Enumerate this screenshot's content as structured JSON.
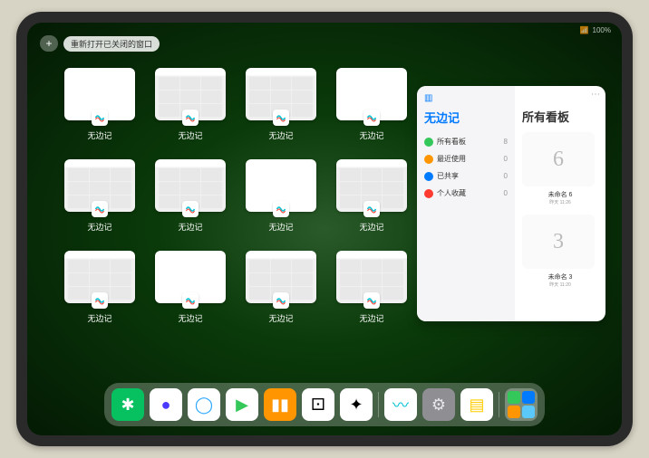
{
  "status": {
    "wifi": "📶",
    "battery": "100%"
  },
  "topbar": {
    "plus": "+",
    "reopen_label": "重新打开已关闭的窗口"
  },
  "windows": [
    {
      "label": "无边记",
      "variant": "blank"
    },
    {
      "label": "无边记",
      "variant": "content"
    },
    {
      "label": "无边记",
      "variant": "content"
    },
    {
      "label": "无边记",
      "variant": "blank"
    },
    {
      "label": "无边记",
      "variant": "content"
    },
    {
      "label": "无边记",
      "variant": "content"
    },
    {
      "label": "无边记",
      "variant": "blank"
    },
    {
      "label": "无边记",
      "variant": "content"
    },
    {
      "label": "无边记",
      "variant": "content"
    },
    {
      "label": "无边记",
      "variant": "blank"
    },
    {
      "label": "无边记",
      "variant": "content"
    },
    {
      "label": "无边记",
      "variant": "content"
    }
  ],
  "panel": {
    "title": "无边记",
    "right_title": "所有看板",
    "items": [
      {
        "label": "所有看板",
        "count": 8,
        "color": "#34c759"
      },
      {
        "label": "最近使用",
        "count": 0,
        "color": "#ff9500"
      },
      {
        "label": "已共享",
        "count": 0,
        "color": "#007aff"
      },
      {
        "label": "个人收藏",
        "count": 0,
        "color": "#ff3b30"
      }
    ],
    "boards": [
      {
        "glyph": "6",
        "name": "未命名 6",
        "time": "昨天 11:26"
      },
      {
        "glyph": "3",
        "name": "未命名 3",
        "time": "昨天 11:20"
      }
    ]
  },
  "dock": {
    "icons": [
      {
        "name": "wechat",
        "bg": "#07c160",
        "glyph": "✱"
      },
      {
        "name": "browser-1",
        "bg": "#ffffff",
        "glyph": "●",
        "fg": "#4a3aff"
      },
      {
        "name": "browser-2",
        "bg": "#ffffff",
        "glyph": "◯",
        "fg": "#2aa7ff"
      },
      {
        "name": "play",
        "bg": "#ffffff",
        "glyph": "▶",
        "fg": "#34c759"
      },
      {
        "name": "books",
        "bg": "#ff9500",
        "glyph": "▮▮",
        "fg": "#fff"
      },
      {
        "name": "dice",
        "bg": "#ffffff",
        "glyph": "⚀",
        "fg": "#000"
      },
      {
        "name": "atoms",
        "bg": "#ffffff",
        "glyph": "✦",
        "fg": "#000"
      },
      {
        "name": "freeform",
        "bg": "#ffffff",
        "glyph": "〰",
        "fg": "#00c2d4"
      },
      {
        "name": "settings",
        "bg": "#8e8e93",
        "glyph": "⚙",
        "fg": "#e5e5ea"
      },
      {
        "name": "notes",
        "bg": "#ffffff",
        "glyph": "▤",
        "fg": "#ffcc00"
      }
    ]
  }
}
